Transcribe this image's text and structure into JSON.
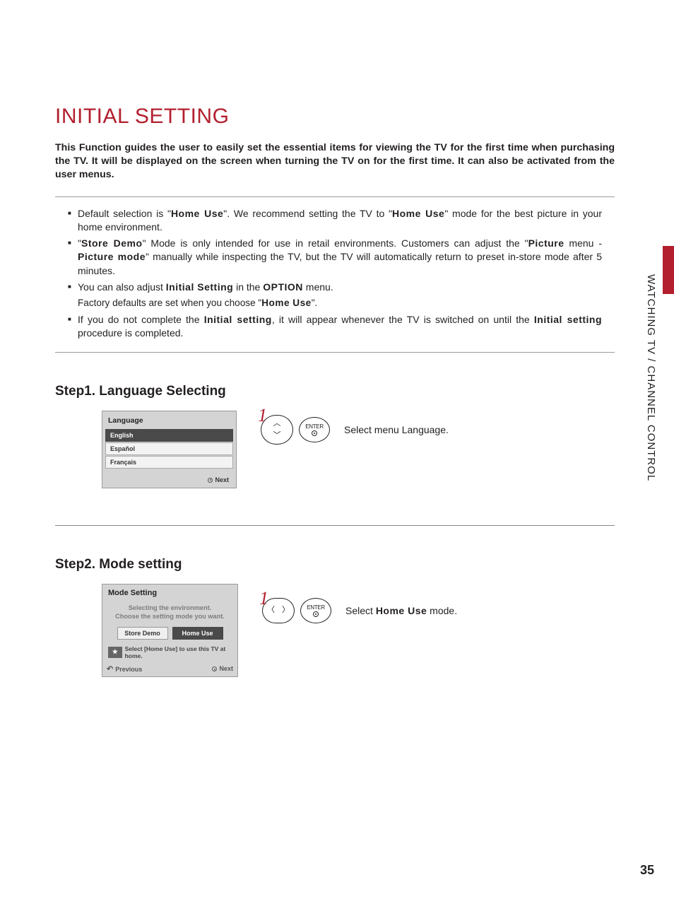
{
  "title": "INITIAL SETTING",
  "intro": "This Function guides the user to easily set the essential items for viewing the TV for the first time when purchasing the TV. It will be displayed on the screen when turning the TV on for the first time. It can also be activated from the user menus.",
  "notes": {
    "b1_pre": "Default selection is \"",
    "b1_bold1": "Home Use",
    "b1_mid": "\". We recommend setting the TV to \"",
    "b1_bold2": "Home Use",
    "b1_post": "\" mode for the best picture in your home environment.",
    "b2_pre": "\"",
    "b2_bold1": "Store Demo",
    "b2_mid1": "\" Mode is only intended for use in retail environments. Customers can adjust the \"",
    "b2_bold2": "Picture",
    "b2_mid2": " menu - ",
    "b2_bold3": "Picture mode",
    "b2_post": "\" manually while inspecting the TV, but the TV will automatically return to preset in-store mode after 5 minutes.",
    "b3_pre": "You can also adjust ",
    "b3_bold1": "Initial Setting",
    "b3_mid": " in the ",
    "b3_bold2": "OPTION",
    "b3_post": " menu.",
    "b3_sub_pre": "Factory defaults are set when you choose \"",
    "b3_sub_bold": "Home Use",
    "b3_sub_post": "\".",
    "b4_pre": "If you do not complete the ",
    "b4_bold1": "Initial setting",
    "b4_mid": ", it will appear whenever the TV is switched on until the ",
    "b4_bold2": "Initial setting",
    "b4_post": " procedure is completed."
  },
  "step1": {
    "title": "Step1. Language Selecting",
    "osd_header": "Language",
    "items": [
      "English",
      "Español",
      "Français"
    ],
    "footer_label": "Next",
    "number": "1",
    "enter": "ENTER",
    "instr": "Select menu Language."
  },
  "step2": {
    "title": "Step2. Mode setting",
    "osd_header": "Mode Setting",
    "desc1": "Selecting the environment.",
    "desc2": "Choose  the  setting mode you want.",
    "btn_store": "Store Demo",
    "btn_home": "Home Use",
    "tip": "Select [Home Use] to use this TV at home.",
    "prev": "Previous",
    "next": "Next",
    "number": "1",
    "enter": "ENTER",
    "instr_pre": "Select ",
    "instr_bold": "Home Use",
    "instr_post": " mode."
  },
  "side_label": "WATCHING TV / CHANNEL CONTROL",
  "page_number": "35"
}
